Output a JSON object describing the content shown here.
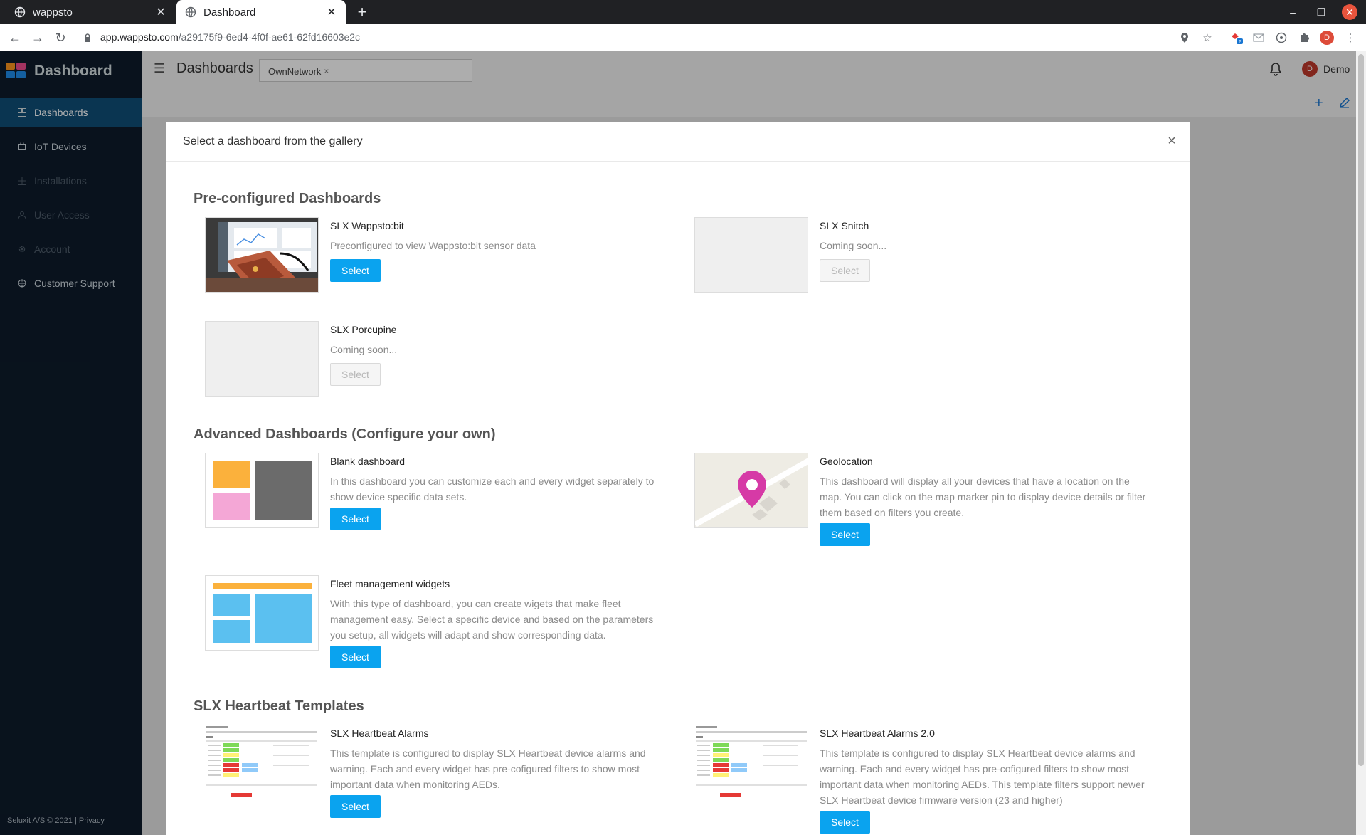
{
  "browser": {
    "tabs": [
      {
        "label": "wappsto",
        "active": false
      },
      {
        "label": "Dashboard",
        "active": true
      }
    ],
    "url_host": "app.wappsto.com",
    "url_path": "/a29175f9-6ed4-4f0f-ae61-62fd16603e2c",
    "extension_badge": "2",
    "profile_initial": "D"
  },
  "sidebar": {
    "brand": "Dashboard",
    "items": [
      {
        "label": "Dashboards",
        "icon": "dashboard-icon",
        "state": "active"
      },
      {
        "label": "IoT Devices",
        "icon": "device-icon",
        "state": "normal"
      },
      {
        "label": "Installations",
        "icon": "grid-icon",
        "state": "disabled"
      },
      {
        "label": "User Access",
        "icon": "user-icon",
        "state": "disabled"
      },
      {
        "label": "Account",
        "icon": "gear-icon",
        "state": "disabled"
      },
      {
        "label": "Customer Support",
        "icon": "globe-icon",
        "state": "normal"
      }
    ],
    "footer": "Seluxit A/S © 2021 | Privacy"
  },
  "topbar": {
    "title": "Dashboards",
    "filter_chip": "OwnNetwork",
    "chip_close": "×",
    "user_initial": "D",
    "user_name": "Demo",
    "add_label": "+"
  },
  "modal": {
    "title": "Select a dashboard from the gallery",
    "close": "×",
    "sections": [
      {
        "title": "Pre-configured Dashboards"
      },
      {
        "title": "Advanced Dashboards (Configure your own)"
      },
      {
        "title": "SLX Heartbeat Templates"
      }
    ],
    "cards": [
      {
        "title": "SLX Wappsto:bit",
        "desc": "Preconfigured to view Wappsto:bit sensor data",
        "button": "Select",
        "enabled": true
      },
      {
        "title": "SLX Snitch",
        "desc": "Coming soon...",
        "button": "Select",
        "enabled": false
      },
      {
        "title": "SLX Porcupine",
        "desc": "Coming soon...",
        "button": "Select",
        "enabled": false
      },
      {
        "title": "Blank dashboard",
        "desc": "In this dashboard you can customize each and every widget separately to show device specific data sets.",
        "button": "Select",
        "enabled": true
      },
      {
        "title": "Geolocation",
        "desc": "This dashboard will display all your devices that have a location on the map. You can click on the map marker pin to display device details or filter them based on filters you create.",
        "button": "Select",
        "enabled": true
      },
      {
        "title": "Fleet management widgets",
        "desc": "With this type of dashboard, you can create wigets that make fleet management easy. Select a specific device and based on the parameters you setup, all widgets will adapt and show corresponding data.",
        "button": "Select",
        "enabled": true
      },
      {
        "title": "SLX Heartbeat Alarms",
        "desc": "This template is configured to display SLX Heartbeat device alarms and warning. Each and every widget has pre-cofigured filters to show most important data when monitoring AEDs.",
        "button": "Select",
        "enabled": true
      },
      {
        "title": "SLX Heartbeat Alarms 2.0",
        "desc": "This template is configured to display SLX Heartbeat device alarms and warning. Each and every widget has pre-cofigured filters to show most important data when monitoring AEDs. This template filters support newer SLX Heartbeat device firmware version (23 and higher)",
        "button": "Select",
        "enabled": true
      }
    ]
  },
  "colors": {
    "sidebar_bg": "#0d1b2a",
    "sidebar_active": "#0f4c75",
    "primary_button": "#0aa3ef",
    "logo_orange": "#f7931e",
    "logo_pink": "#e84a8a",
    "logo_blue": "#1e88e5"
  }
}
